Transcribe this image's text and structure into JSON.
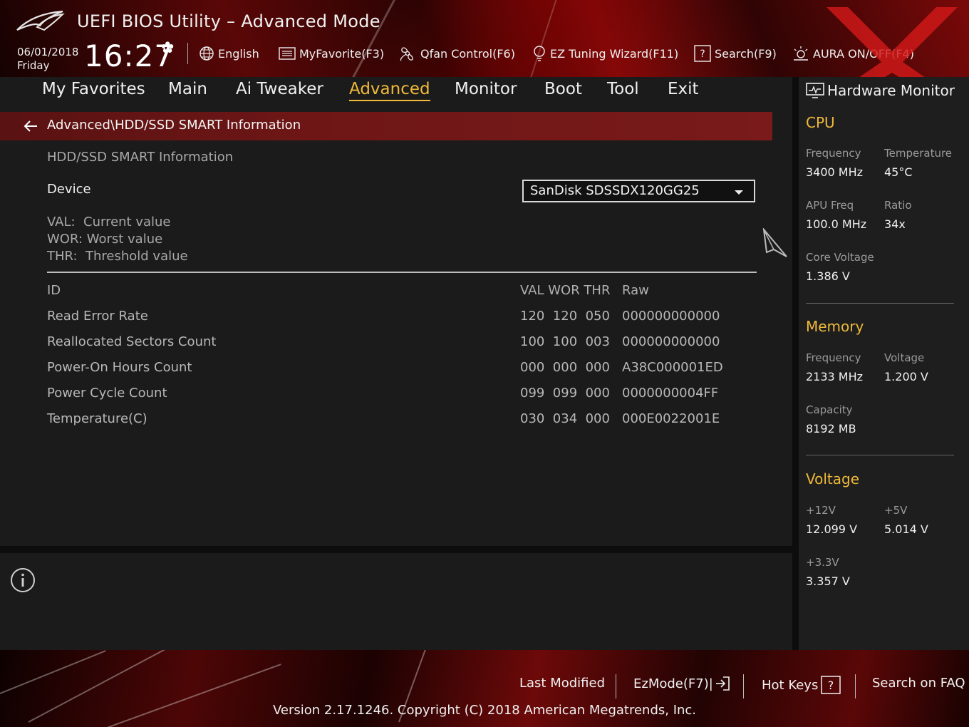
{
  "window": {
    "title": "UEFI BIOS Utility – Advanced Mode"
  },
  "datetime": {
    "date": "06/01/2018",
    "day": "Friday",
    "time": "16:27"
  },
  "toolbar": {
    "language": "English",
    "myfavorite": "MyFavorite(F3)",
    "qfan": "Qfan Control(F6)",
    "ez_tuning": "EZ Tuning Wizard(F11)",
    "search": "Search(F9)",
    "aura": "AURA ON/OFF(F4)"
  },
  "nav": {
    "tabs": [
      {
        "label": "My Favorites"
      },
      {
        "label": "Main"
      },
      {
        "label": "Ai Tweaker"
      },
      {
        "label": "Advanced"
      },
      {
        "label": "Monitor"
      },
      {
        "label": "Boot"
      },
      {
        "label": "Tool"
      },
      {
        "label": "Exit"
      }
    ],
    "active": "Advanced"
  },
  "page": {
    "breadcrumb": "Advanced\\HDD/SSD SMART Information",
    "subtitle": "HDD/SSD SMART Information",
    "device_label": "Device",
    "device_value": "SanDisk SDSSDX120GG25",
    "legend": [
      "VAL:  Current value",
      "WOR: Worst value",
      "THR:  Threshold value"
    ]
  },
  "smart_table": {
    "headers": {
      "id": "ID",
      "vals": "VAL WOR THR",
      "raw": "Raw"
    },
    "rows": [
      {
        "name": "Read Error Rate",
        "vals": "120  120  050",
        "raw": "000000000000"
      },
      {
        "name": "Reallocated Sectors Count",
        "vals": "100  100  003",
        "raw": "000000000000"
      },
      {
        "name": "Power-On Hours Count",
        "vals": "000  000  000",
        "raw": "A38C000001ED"
      },
      {
        "name": "Power Cycle Count",
        "vals": "099  099  000",
        "raw": "0000000004FF"
      },
      {
        "name": "Temperature(C)",
        "vals": "030  034  000",
        "raw": "000E0022001E"
      }
    ]
  },
  "hardware_monitor": {
    "title": "Hardware Monitor",
    "cpu": {
      "section": "CPU",
      "frequency_label": "Frequency",
      "frequency": "3400 MHz",
      "temperature_label": "Temperature",
      "temperature": "45°C",
      "apu_freq_label": "APU Freq",
      "apu_freq": "100.0 MHz",
      "ratio_label": "Ratio",
      "ratio": "34x",
      "core_voltage_label": "Core Voltage",
      "core_voltage": "1.386 V"
    },
    "memory": {
      "section": "Memory",
      "frequency_label": "Frequency",
      "frequency": "2133 MHz",
      "voltage_label": "Voltage",
      "voltage": "1.200 V",
      "capacity_label": "Capacity",
      "capacity": "8192 MB"
    },
    "voltage": {
      "section": "Voltage",
      "v12_label": "+12V",
      "v12": "12.099 V",
      "v5_label": "+5V",
      "v5": "5.014 V",
      "v33_label": "+3.3V",
      "v33": "3.357 V"
    }
  },
  "footer": {
    "last_modified": "Last Modified",
    "ezmode": "EzMode(F7)|",
    "hot_keys": "Hot Keys",
    "search_faq": "Search on FAQ",
    "version": "Version 2.17.1246. Copyright (C) 2018 American Megatrends, Inc."
  },
  "colors": {
    "accent": "#f0b93a",
    "brand_red": "#8a0a0a",
    "background": "#1b1b1b"
  }
}
